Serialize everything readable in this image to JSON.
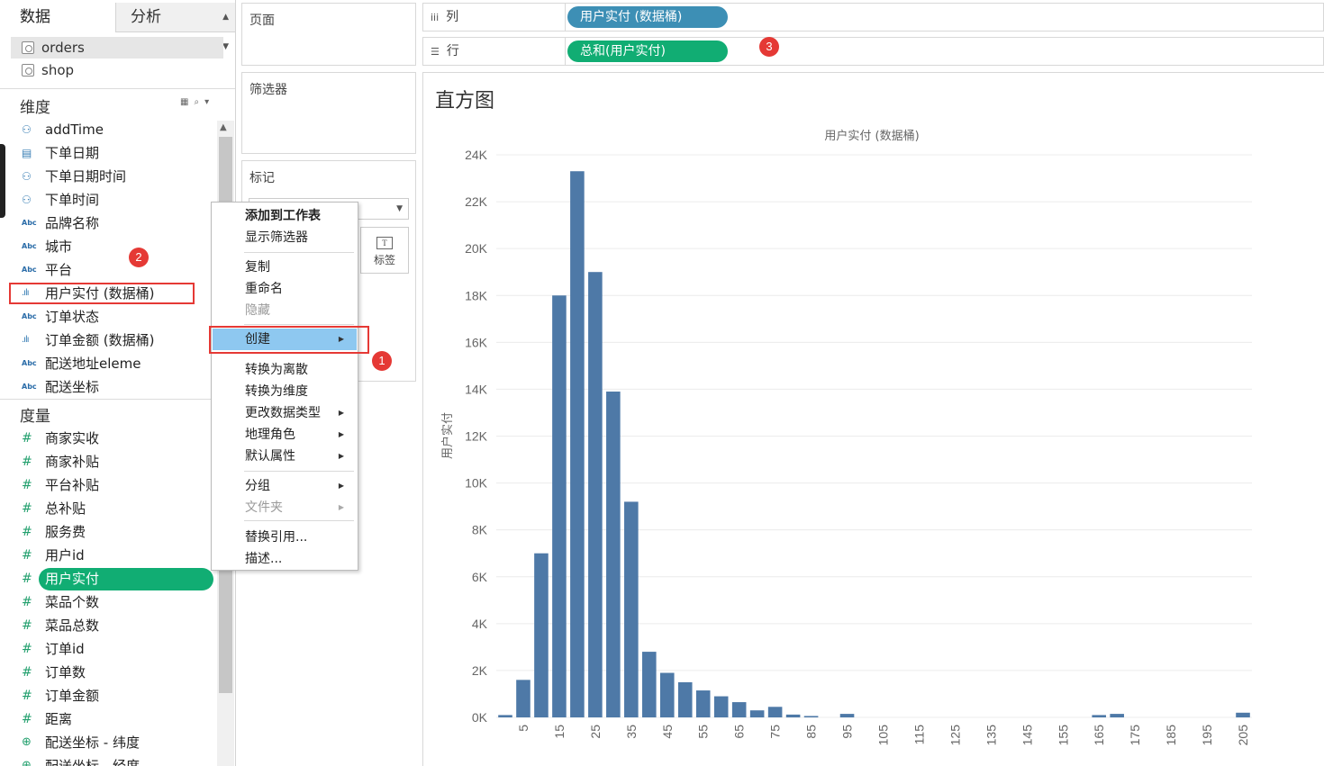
{
  "left_pane": {
    "tabs": {
      "data": "数据",
      "analysis": "分析"
    },
    "datasources": [
      {
        "name": "orders",
        "selected": true
      },
      {
        "name": "shop",
        "selected": false
      }
    ],
    "dimensions_title": "维度",
    "measures_title": "度量",
    "dimensions": [
      {
        "name": "addTime",
        "icon": "calendar-time-icon"
      },
      {
        "name": "下单日期",
        "icon": "calendar-icon"
      },
      {
        "name": "下单日期时间",
        "icon": "calendar-time-icon"
      },
      {
        "name": "下单时间",
        "icon": "calendar-time-icon"
      },
      {
        "name": "品牌名称",
        "icon": "abc-icon"
      },
      {
        "name": "城市",
        "icon": "abc-icon"
      },
      {
        "name": "平台",
        "icon": "abc-icon"
      },
      {
        "name": "用户实付 (数据桶)",
        "icon": "bin-icon"
      },
      {
        "name": "订单状态",
        "icon": "abc-icon"
      },
      {
        "name": "订单金额 (数据桶)",
        "icon": "bin-icon"
      },
      {
        "name": "配送地址eleme",
        "icon": "abc-icon"
      },
      {
        "name": "配送坐标",
        "icon": "abc-icon"
      }
    ],
    "measures": [
      {
        "name": "商家实收",
        "icon": "hash-icon"
      },
      {
        "name": "商家补贴",
        "icon": "hash-icon"
      },
      {
        "name": "平台补贴",
        "icon": "hash-icon"
      },
      {
        "name": "总补贴",
        "icon": "hash-icon"
      },
      {
        "name": "服务费",
        "icon": "hash-icon"
      },
      {
        "name": "用户id",
        "icon": "hash-icon"
      },
      {
        "name": "用户实付",
        "icon": "hash-icon"
      },
      {
        "name": "菜品个数",
        "icon": "hash-icon"
      },
      {
        "name": "菜品总数",
        "icon": "hash-icon"
      },
      {
        "name": "订单id",
        "icon": "hash-icon"
      },
      {
        "name": "订单数",
        "icon": "hash-icon"
      },
      {
        "name": "订单金额",
        "icon": "hash-icon"
      },
      {
        "name": "距离",
        "icon": "hash-icon"
      },
      {
        "name": "配送坐标 - 纬度",
        "icon": "globe-icon"
      },
      {
        "name": "配送坐标 - 经度",
        "icon": "globe-icon"
      }
    ]
  },
  "cards": {
    "pages": "页面",
    "filters": "筛选器",
    "marks": "标记",
    "label_button": "标签"
  },
  "context_menu": {
    "items": [
      {
        "label": "添加到工作表",
        "style": "bold"
      },
      {
        "label": "显示筛选器",
        "style": "normal"
      },
      {
        "label": "复制",
        "style": "normal"
      },
      {
        "label": "重命名",
        "style": "normal"
      },
      {
        "label": "隐藏",
        "style": "disabled"
      },
      {
        "label": "创建",
        "style": "active",
        "submenu": true
      },
      {
        "label": "转换为离散",
        "style": "normal"
      },
      {
        "label": "转换为维度",
        "style": "normal"
      },
      {
        "label": "更改数据类型",
        "style": "normal",
        "submenu": true
      },
      {
        "label": "地理角色",
        "style": "normal",
        "submenu": true
      },
      {
        "label": "默认属性",
        "style": "normal",
        "submenu": true
      },
      {
        "label": "分组",
        "style": "normal",
        "submenu": true
      },
      {
        "label": "文件夹",
        "style": "disabled",
        "submenu": true
      },
      {
        "label": "替换引用...",
        "style": "normal"
      },
      {
        "label": "描述...",
        "style": "normal"
      }
    ]
  },
  "shelves": {
    "columns": {
      "label": "列",
      "pill": "用户实付 (数据桶)",
      "pill_color": "#3d8fb5"
    },
    "rows": {
      "label": "行",
      "pill": "总和(用户实付)",
      "pill_color": "#11ad73"
    }
  },
  "annotations": {
    "badge1": "1",
    "badge2": "2",
    "badge3": "3"
  },
  "view": {
    "title": "直方图"
  },
  "chart_data": {
    "type": "bar",
    "title": "用户实付 (数据桶)",
    "xlabel": "用户实付 (数据桶)",
    "ylabel": "用户实付",
    "bar_color": "#4e79a7",
    "ylim": [
      0,
      24000
    ],
    "y_ticks": [
      "0K",
      "2K",
      "4K",
      "6K",
      "8K",
      "10K",
      "12K",
      "14K",
      "16K",
      "18K",
      "20K",
      "22K",
      "24K"
    ],
    "y_tick_values": [
      0,
      2000,
      4000,
      6000,
      8000,
      10000,
      12000,
      14000,
      16000,
      18000,
      20000,
      22000,
      24000
    ],
    "x_tick_labels": [
      "5",
      "15",
      "25",
      "35",
      "45",
      "55",
      "65",
      "75",
      "85",
      "95",
      "105",
      "115",
      "125",
      "135",
      "145",
      "155",
      "165",
      "175",
      "185",
      "195",
      "205"
    ],
    "bins": [
      0,
      5,
      10,
      15,
      20,
      25,
      30,
      35,
      40,
      45,
      50,
      55,
      60,
      65,
      70,
      75,
      80,
      85,
      90,
      95,
      100,
      105,
      110,
      115,
      120,
      125,
      130,
      135,
      140,
      145,
      150,
      155,
      160,
      165,
      170,
      175,
      180,
      185,
      190,
      195,
      200,
      205
    ],
    "values": [
      100,
      1600,
      7000,
      18000,
      23300,
      19000,
      13900,
      9200,
      2800,
      1900,
      1500,
      1150,
      900,
      650,
      300,
      450,
      120,
      60,
      0,
      150,
      0,
      0,
      0,
      0,
      0,
      0,
      0,
      0,
      0,
      0,
      0,
      0,
      0,
      100,
      150,
      0,
      0,
      0,
      0,
      0,
      0,
      200
    ]
  }
}
